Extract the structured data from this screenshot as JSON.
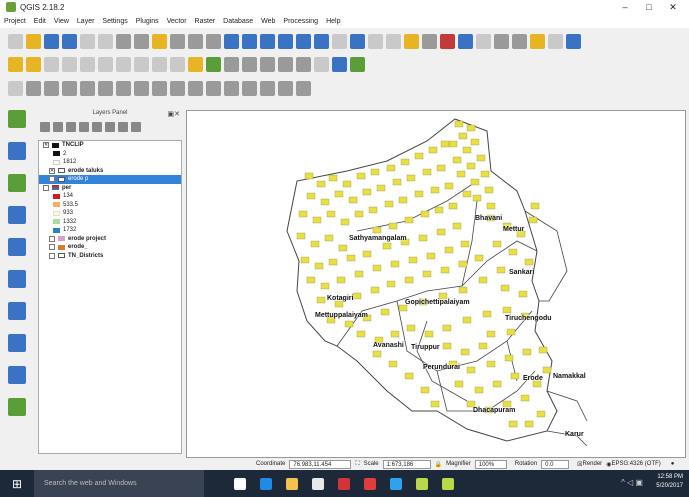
{
  "window": {
    "title": "QGIS 2.18.2",
    "min": "–",
    "max": "□",
    "close": "✕"
  },
  "menu": [
    "Project",
    "Edit",
    "View",
    "Layer",
    "Settings",
    "Plugins",
    "Vector",
    "Raster",
    "Database",
    "Web",
    "Processing",
    "Help"
  ],
  "layers_panel": {
    "title": "Layers Panel",
    "items": [
      {
        "label": "TNCLIP",
        "checked": true,
        "bold": true,
        "swatch": "#111111"
      },
      {
        "label": "2",
        "swatch": "#111111"
      },
      {
        "label": "1812",
        "swatch": "#ffffff"
      },
      {
        "label": "erode taluks",
        "checked": true,
        "bold": true,
        "swatch": ""
      },
      {
        "label": "erode p",
        "checked": true,
        "bold": false,
        "swatch": "",
        "selected": true
      },
      {
        "label": "per",
        "checked": false,
        "bold": true,
        "swatch": ""
      },
      {
        "label": "134",
        "swatch": "#d7191c"
      },
      {
        "label": "533.5",
        "swatch": "#fdae61"
      },
      {
        "label": "933",
        "swatch": "#ffffbf"
      },
      {
        "label": "1332",
        "swatch": "#abdda4"
      },
      {
        "label": "1732",
        "swatch": "#2b83ba"
      },
      {
        "label": "erode project",
        "checked": false,
        "bold": true,
        "swatch": "#d9a0c8"
      },
      {
        "label": "erode_",
        "checked": false,
        "bold": true,
        "swatch": "#d47c2c"
      },
      {
        "label": "TN_Districts",
        "checked": false,
        "bold": true,
        "swatch": ""
      }
    ]
  },
  "map_labels": [
    "Bhavani",
    "Mettur",
    "Sathyamangalam",
    "Sankari",
    "Kotagiri",
    "Gopichettipalaiyam",
    "Mettuppalaiyam",
    "Tiruchengodu",
    "Avanashi",
    "Tiruppur",
    "Perundurai",
    "Erode",
    "Namakkal",
    "Dhacapuram",
    "Karur"
  ],
  "status": {
    "coordinate_label": "Coordinate",
    "coordinate": "76.983,11.454",
    "scale_label": "Scale",
    "scale": "1:673,186",
    "magnifier_label": "Magnifier",
    "magnifier": "100%",
    "rotation_label": "Rotation",
    "rotation": "0.0",
    "render_label": "Render",
    "crs": "EPSG:4326 (OTF)"
  },
  "taskbar": {
    "search_placeholder": "Search the web and Windows",
    "time": "12:58 PM",
    "date": "5/20/2017"
  }
}
